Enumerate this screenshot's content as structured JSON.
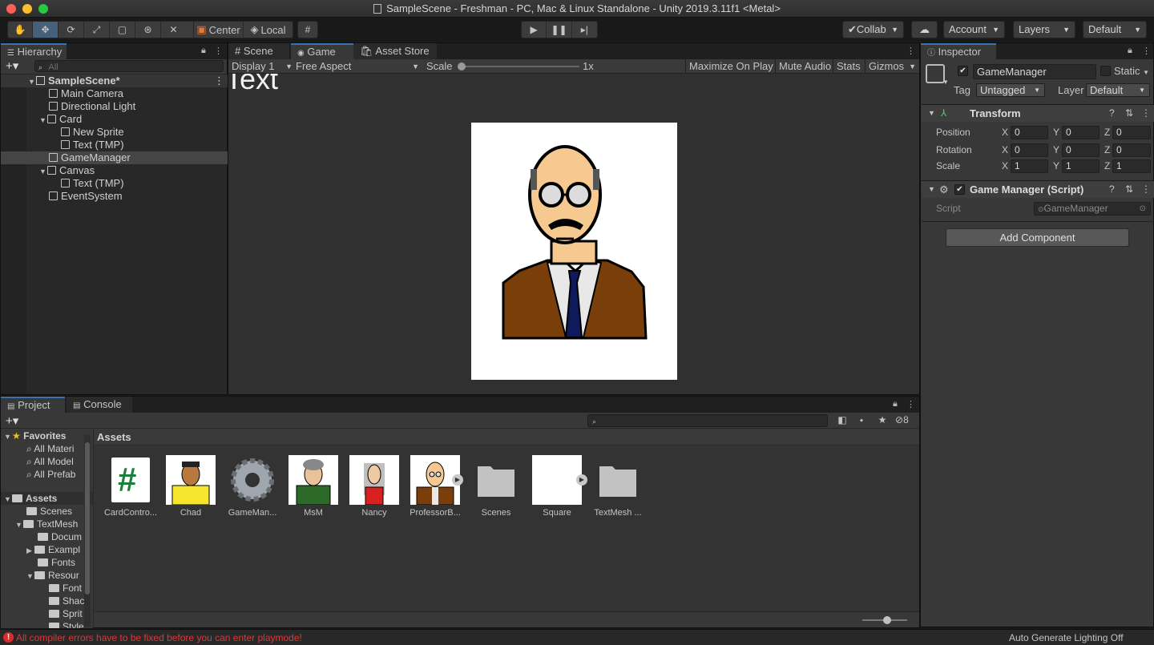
{
  "window": {
    "title": "SampleScene - Freshman - PC, Mac & Linux Standalone - Unity 2019.3.11f1 <Metal>",
    "traffic_colors": [
      "#ff5f57",
      "#febc2e",
      "#28c840"
    ]
  },
  "toolbar": {
    "pivot_label": "Center",
    "space_label": "Local",
    "collab_label": "Collab",
    "account_label": "Account",
    "layers_label": "Layers",
    "layout_label": "Default"
  },
  "hierarchy": {
    "tab_label": "Hierarchy",
    "search_placeholder": "All",
    "scene_name": "SampleScene*",
    "items": [
      {
        "label": "Main Camera"
      },
      {
        "label": "Directional Light"
      },
      {
        "label": "Card"
      },
      {
        "label": "New Sprite"
      },
      {
        "label": "Text (TMP)"
      },
      {
        "label": "GameManager"
      },
      {
        "label": "Canvas"
      },
      {
        "label": "Text (TMP)"
      },
      {
        "label": "EventSystem"
      }
    ]
  },
  "game_view": {
    "tabs": [
      "Scene",
      "Game",
      "Asset Store"
    ],
    "display": "Display 1",
    "aspect": "Free Aspect",
    "scale_label": "Scale",
    "scale_value": "1x",
    "maximize": "Maximize On Play",
    "mute": "Mute Audio",
    "stats": "Stats",
    "gizmos": "Gizmos",
    "overlay_text": "Text"
  },
  "inspector": {
    "tab_label": "Inspector",
    "object_name": "GameManager",
    "static_label": "Static",
    "tag_label": "Tag",
    "tag_value": "Untagged",
    "layer_label": "Layer",
    "layer_value": "Default",
    "transform": {
      "title": "Transform",
      "position_label": "Position",
      "rotation_label": "Rotation",
      "scale_label": "Scale",
      "axis_x": "X",
      "axis_y": "Y",
      "axis_z": "Z",
      "position": [
        "0",
        "0",
        "0"
      ],
      "rotation": [
        "0",
        "0",
        "0"
      ],
      "scale": [
        "1",
        "1",
        "1"
      ]
    },
    "script_component": {
      "title": "Game Manager (Script)",
      "script_label": "Script",
      "script_value": "GameManager"
    },
    "add_component": "Add Component"
  },
  "project": {
    "tabs": [
      "Project",
      "Console"
    ],
    "hidden_count": "8",
    "breadcrumb": "Assets",
    "favorites_label": "Favorites",
    "favorites": [
      "All Materi",
      "All Model",
      "All Prefab"
    ],
    "assets_label": "Assets",
    "tree": [
      "Scenes",
      "TextMesh",
      "Docum",
      "Exampl",
      "Fonts",
      "Resour",
      "Font",
      "Shac",
      "Sprit",
      "Style"
    ],
    "assets": [
      {
        "label": "CardContro...",
        "kind": "script"
      },
      {
        "label": "Chad",
        "kind": "sprite"
      },
      {
        "label": "GameMan...",
        "kind": "gear"
      },
      {
        "label": "MsM",
        "kind": "sprite"
      },
      {
        "label": "Nancy",
        "kind": "sprite"
      },
      {
        "label": "ProfessorB...",
        "kind": "sprite"
      },
      {
        "label": "Scenes",
        "kind": "folder"
      },
      {
        "label": "Square",
        "kind": "square"
      },
      {
        "label": "TextMesh ...",
        "kind": "folder"
      }
    ]
  },
  "statusbar": {
    "error": "All compiler errors have to be fixed before you can enter playmode!",
    "lighting": "Auto Generate Lighting Off"
  }
}
